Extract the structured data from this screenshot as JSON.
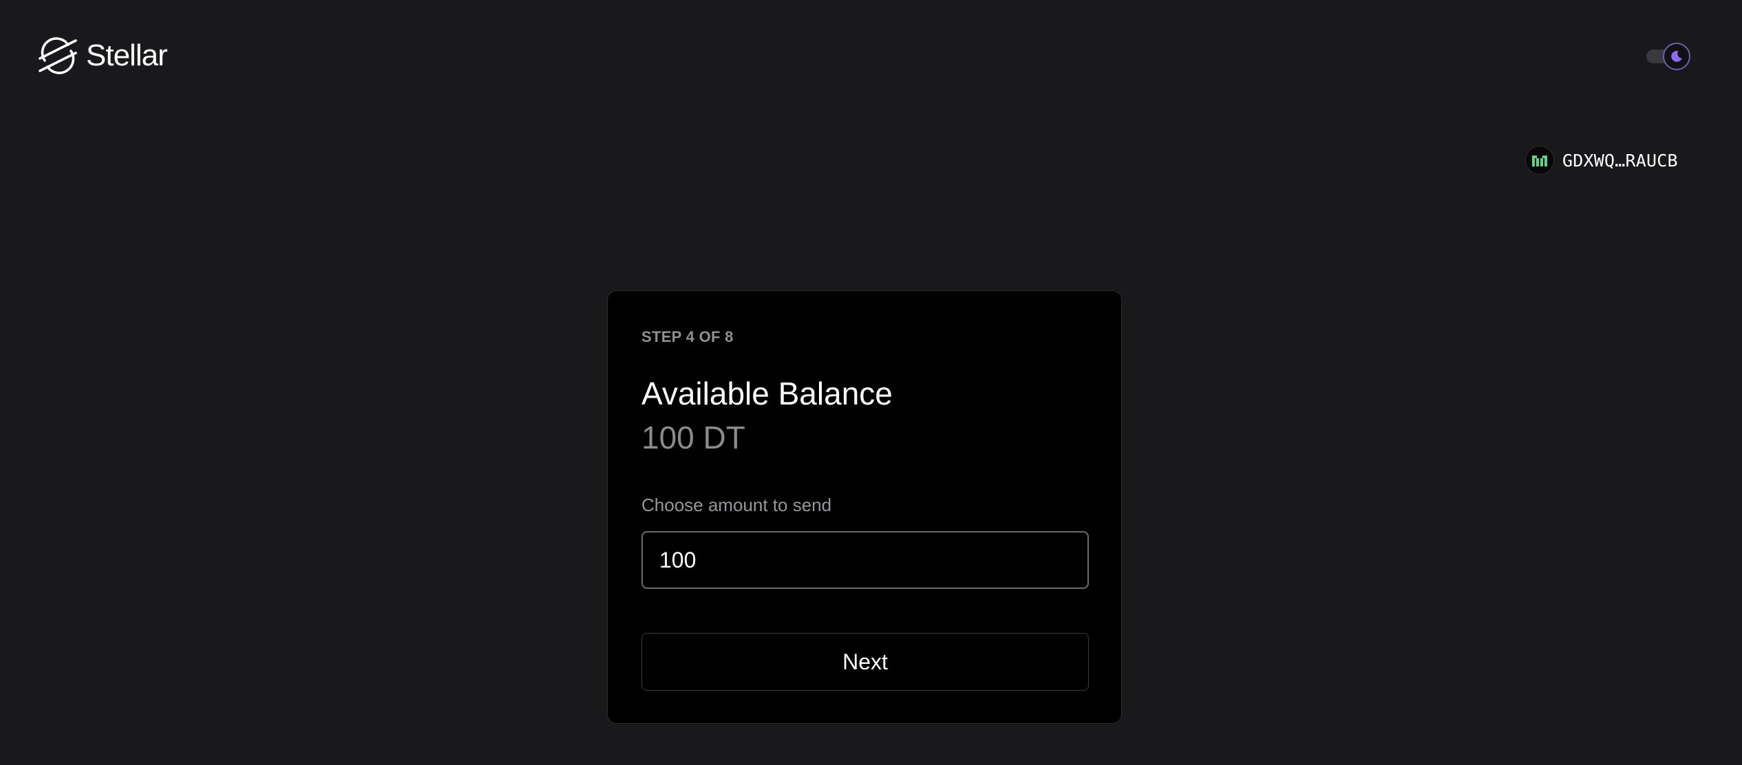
{
  "header": {
    "logo_text": "Stellar",
    "logo_icon": "stellar-logo-icon",
    "theme_toggle": {
      "icon": "moon-icon",
      "state": "dark",
      "accent_color": "#8b6cf0"
    }
  },
  "account": {
    "address": "GDXWQ…RAUCB",
    "avatar_icon": "identicon",
    "avatar_color": "#5fd38a"
  },
  "card": {
    "step": "STEP 4 OF 8",
    "title": "Available Balance",
    "balance": "100 DT",
    "amount_label": "Choose amount to send",
    "amount_value": "100",
    "next_label": "Next"
  },
  "colors": {
    "page_bg": "#19191b",
    "card_bg": "#000000",
    "muted_text": "#8a8a8f"
  }
}
